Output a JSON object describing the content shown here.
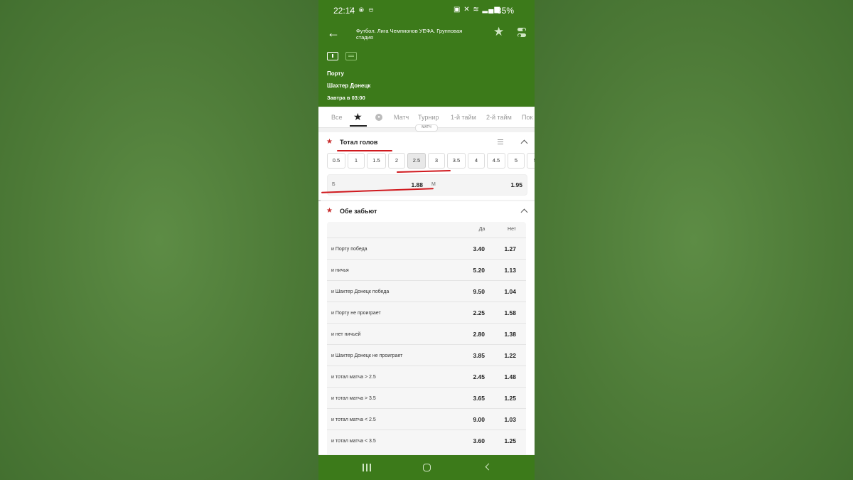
{
  "status_bar": {
    "time": "22:14",
    "left_icons": "⛶ ⦿ ⊖",
    "right_icons": "▣ ✕ ≋ ▂▄▆",
    "battery": "35%"
  },
  "header": {
    "title": "Футбол. Лига Чемпионов УЕФА. Групповая стадия",
    "team_home": "Порту",
    "team_away": "Шахтер Донецк",
    "start_time": "Завтра в 03:00"
  },
  "tabs": {
    "all": "Все",
    "match": "Матч",
    "tournament": "Турнир",
    "first_half": "1-й тайм",
    "second_half": "2-й тайм",
    "more": "Пок",
    "tooltip": "МАТЧ"
  },
  "total_goals": {
    "title": "Тотал голов",
    "lines": [
      "0.5",
      "1",
      "1.5",
      "2",
      "2.5",
      "3",
      "3.5",
      "4",
      "4.5",
      "5",
      "5"
    ],
    "selected": "2.5",
    "over_label": "Б",
    "over_value": "1.88",
    "under_label": "М",
    "under_value": "1.95"
  },
  "both_score": {
    "title": "Обе забьют",
    "col_yes": "Да",
    "col_no": "Нет",
    "rows": [
      {
        "label": "и Порту победа",
        "yes": "3.40",
        "no": "1.27"
      },
      {
        "label": "и ничья",
        "yes": "5.20",
        "no": "1.13"
      },
      {
        "label": "и Шахтер Донецк победа",
        "yes": "9.50",
        "no": "1.04"
      },
      {
        "label": "и Порту не проиграет",
        "yes": "2.25",
        "no": "1.58"
      },
      {
        "label": "и нет ничьей",
        "yes": "2.80",
        "no": "1.38"
      },
      {
        "label": "и Шахтер Донецк не проиграет",
        "yes": "3.85",
        "no": "1.22"
      },
      {
        "label": "и тотал матча > 2.5",
        "yes": "2.45",
        "no": "1.48"
      },
      {
        "label": "и тотал матча > 3.5",
        "yes": "3.65",
        "no": "1.25"
      },
      {
        "label": "и тотал матча < 2.5",
        "yes": "9.00",
        "no": "1.03"
      },
      {
        "label": "и тотал матча < 3.5",
        "yes": "3.60",
        "no": "1.25"
      }
    ]
  },
  "colors": {
    "header_green": "#3c7a1a",
    "accent_red": "#c62828",
    "annotation_red": "#d0191e"
  }
}
